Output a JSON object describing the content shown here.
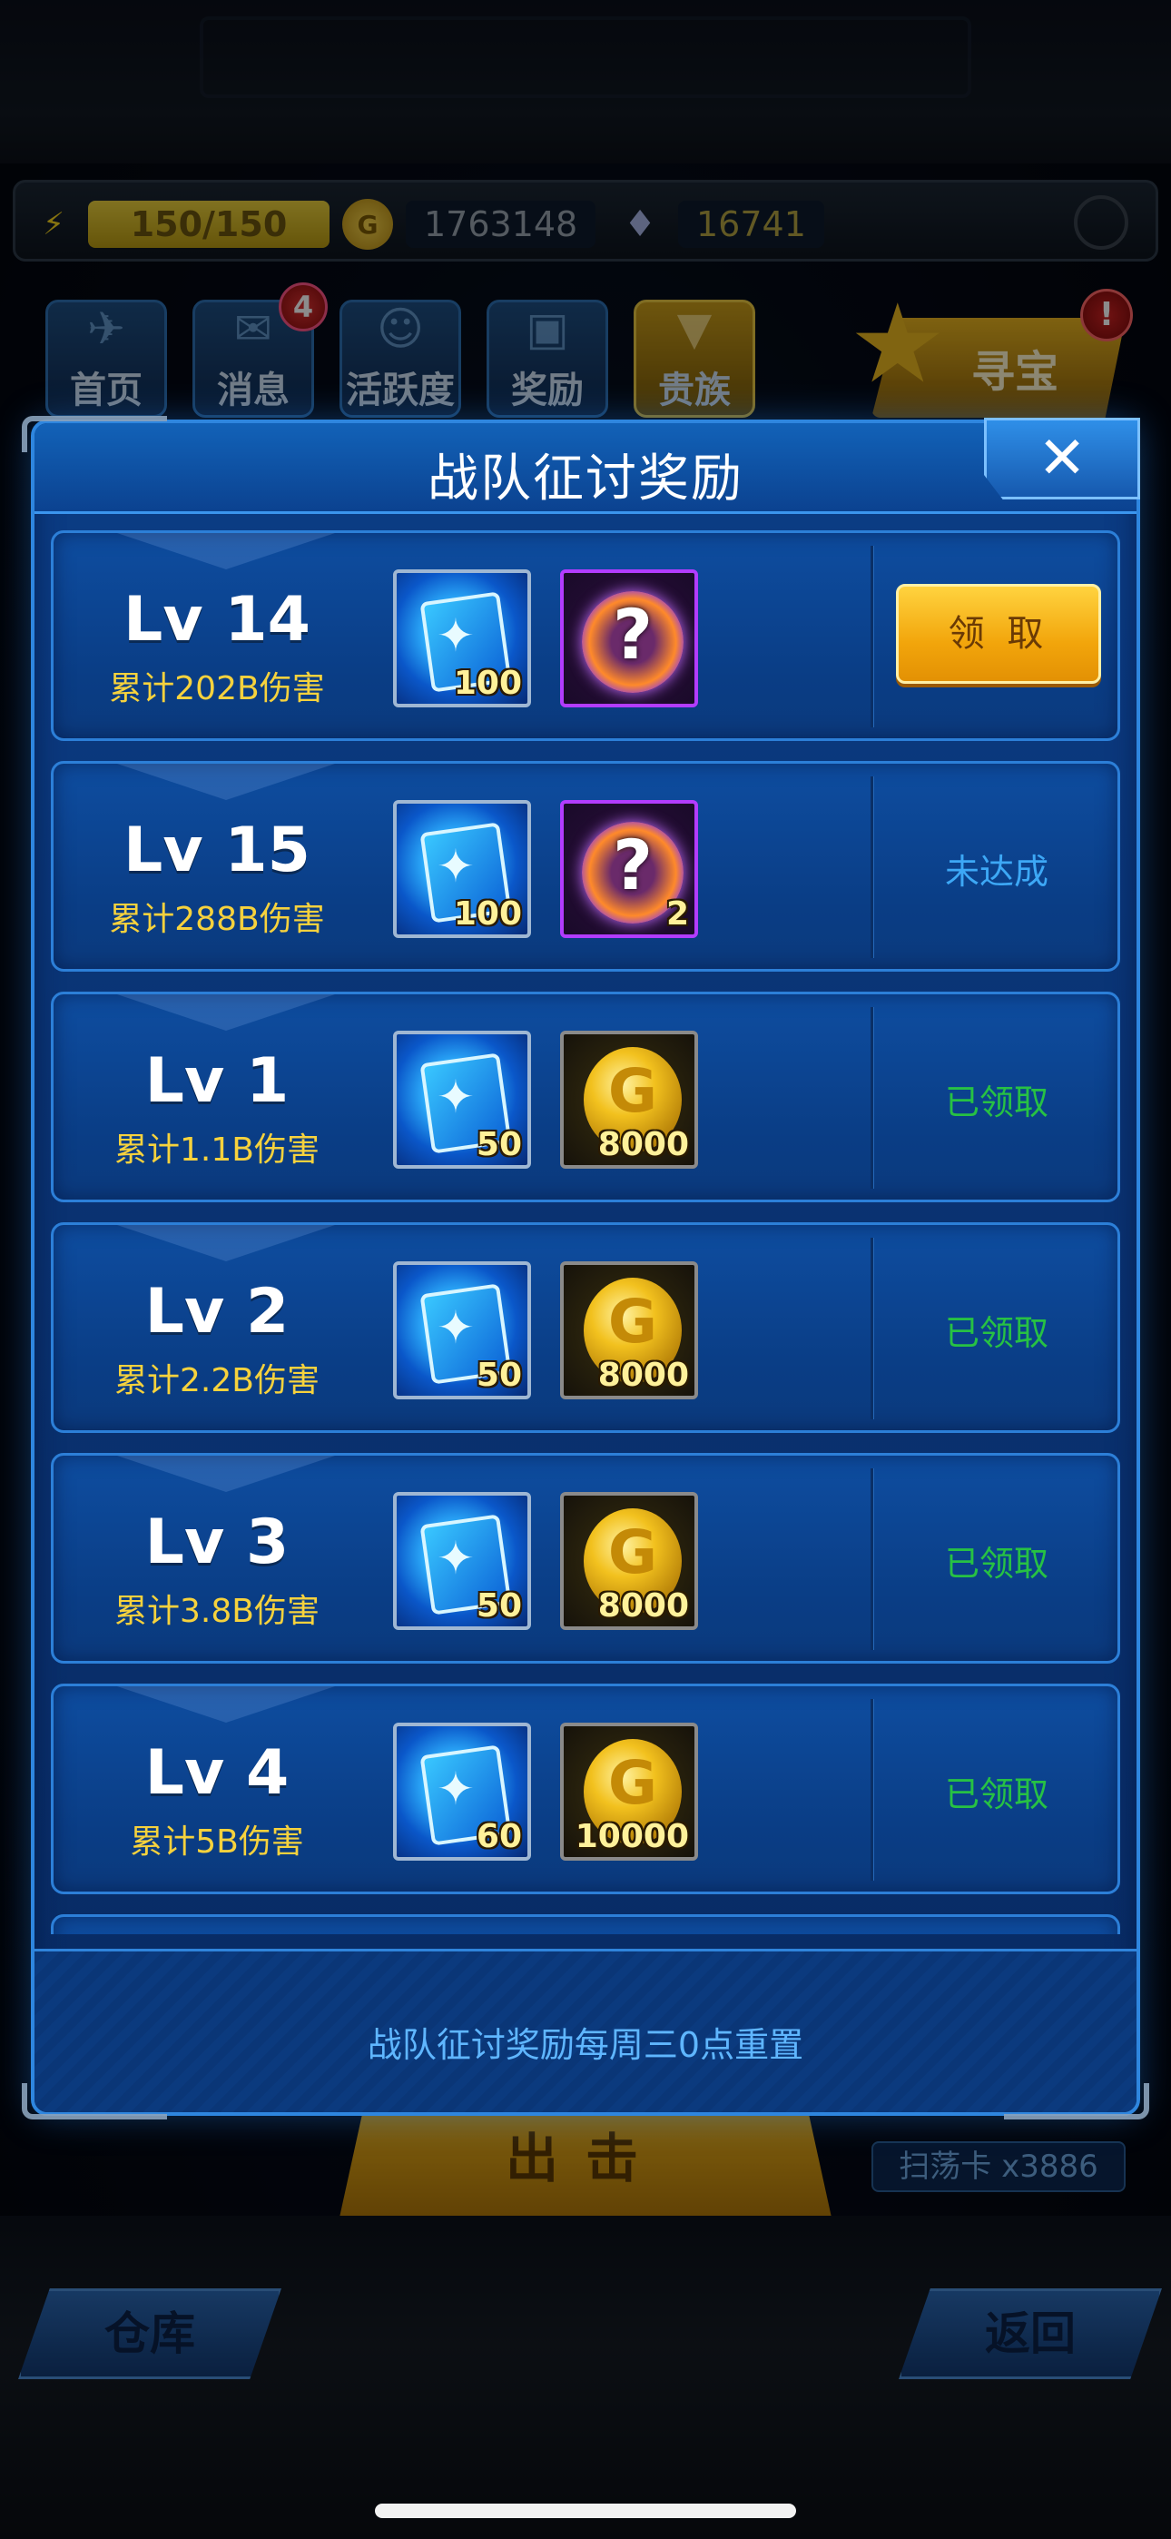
{
  "background": {
    "resources": {
      "energy": "150/150",
      "coins": "1763148",
      "gems": "16741"
    },
    "nav": [
      {
        "label": "首页",
        "icon": "fighter-icon"
      },
      {
        "label": "消息",
        "icon": "envelope-icon",
        "badge": "4"
      },
      {
        "label": "活跃度",
        "icon": "smile-icon"
      },
      {
        "label": "奖励",
        "icon": "gift-icon"
      },
      {
        "label": "贵族",
        "icon": "vip-icon"
      }
    ],
    "treasure": {
      "label": "寻宝",
      "badge": "!"
    },
    "attack_label": "出击",
    "sweep_card": "扫荡卡 x3886",
    "warehouse_label": "仓库",
    "back_label": "返回"
  },
  "modal": {
    "title": "战队征讨奖励",
    "close_glyph": "✕",
    "footer_note": "战队征讨奖励每周三0点重置",
    "rows": [
      {
        "level": "Lv 14",
        "damage": "累计202B伤害",
        "items": [
          {
            "type": "card",
            "count": "100"
          },
          {
            "type": "mystery-orb",
            "count": ""
          }
        ],
        "status": "claim",
        "status_label": "领 取"
      },
      {
        "level": "Lv 15",
        "damage": "累计288B伤害",
        "items": [
          {
            "type": "card",
            "count": "100"
          },
          {
            "type": "mystery-orb",
            "count": "2"
          }
        ],
        "status": "unreached",
        "status_label": "未达成"
      },
      {
        "level": "Lv 1",
        "damage": "累计1.1B伤害",
        "items": [
          {
            "type": "card",
            "count": "50"
          },
          {
            "type": "gold-coin",
            "count": "8000"
          }
        ],
        "status": "claimed",
        "status_label": "已领取"
      },
      {
        "level": "Lv 2",
        "damage": "累计2.2B伤害",
        "items": [
          {
            "type": "card",
            "count": "50"
          },
          {
            "type": "gold-coin",
            "count": "8000"
          }
        ],
        "status": "claimed",
        "status_label": "已领取"
      },
      {
        "level": "Lv 3",
        "damage": "累计3.8B伤害",
        "items": [
          {
            "type": "card",
            "count": "50"
          },
          {
            "type": "gold-coin",
            "count": "8000"
          }
        ],
        "status": "claimed",
        "status_label": "已领取"
      },
      {
        "level": "Lv 4",
        "damage": "累计5B伤害",
        "items": [
          {
            "type": "card",
            "count": "60"
          },
          {
            "type": "gold-coin",
            "count": "10000"
          }
        ],
        "status": "claimed",
        "status_label": "已领取"
      }
    ]
  },
  "colors": {
    "claim_button": "#f2a50b",
    "claimed_text": "#27c144",
    "unreached_text": "#3da8f6",
    "damage_text": "#f6d23d"
  }
}
